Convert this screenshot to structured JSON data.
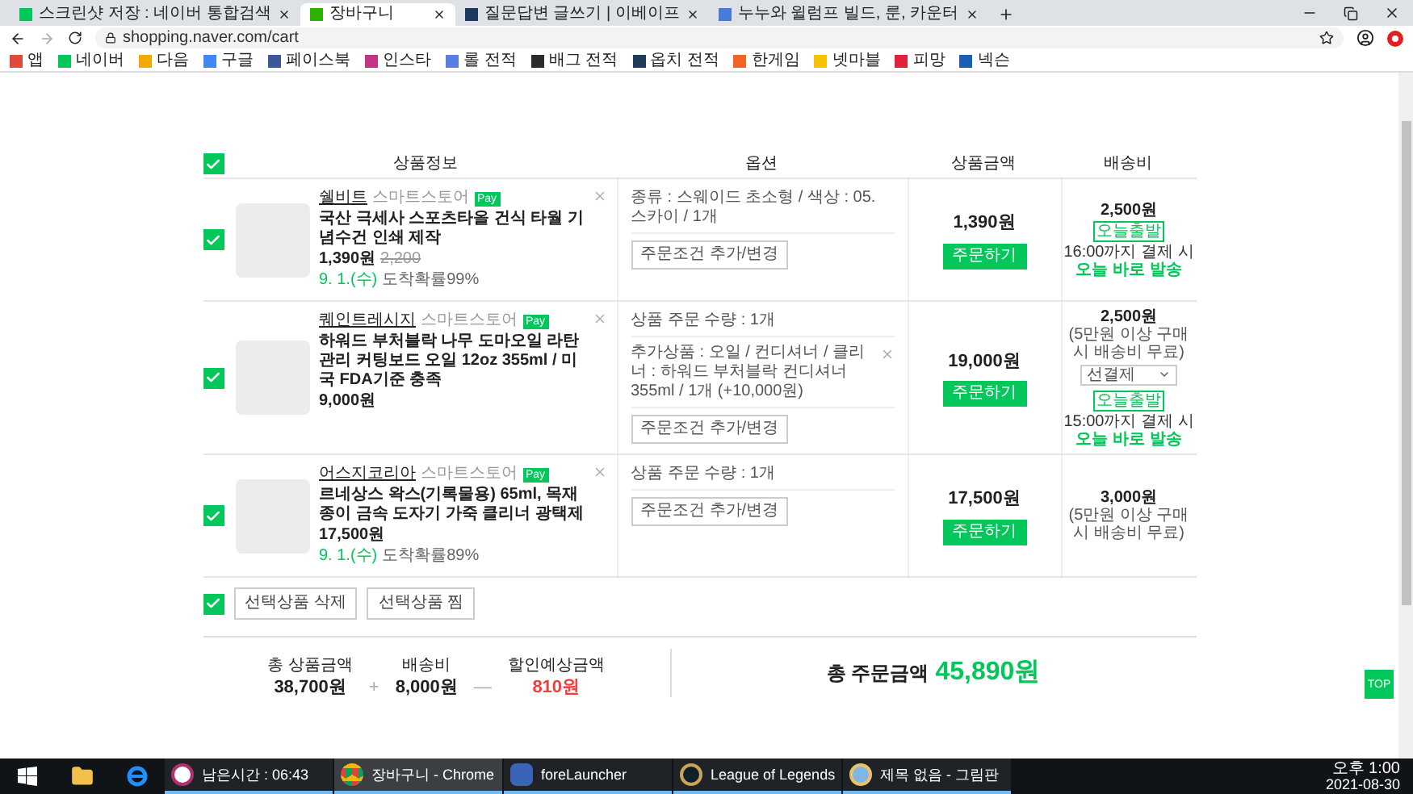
{
  "browser": {
    "tabs": [
      {
        "title": "스크린샷 저장 : 네이버 통합검색",
        "selected": false,
        "color": "#03c75a"
      },
      {
        "title": "장바구니",
        "selected": true,
        "color": "#2db400"
      },
      {
        "title": "질문답변 글쓰기 | 이베이프",
        "selected": false,
        "color": "#1e3a5f"
      },
      {
        "title": "누누와 윌럼프 빌드, 룬, 카운터",
        "selected": false,
        "color": "#4a7bd8"
      }
    ],
    "url": "shopping.naver.com/cart",
    "bookmarks": [
      {
        "label": "앱",
        "color": "#e04a3a"
      },
      {
        "label": "네이버",
        "color": "#03c75a"
      },
      {
        "label": "다음",
        "color": "#f2a900"
      },
      {
        "label": "구글",
        "color": "#4285f4"
      },
      {
        "label": "페이스북",
        "color": "#3b5998"
      },
      {
        "label": "인스타",
        "color": "#c13584"
      },
      {
        "label": "롤 전적",
        "color": "#5b7fde"
      },
      {
        "label": "배그 전적",
        "color": "#2b2b2b"
      },
      {
        "label": "옵치 전적",
        "color": "#1f3b5a"
      },
      {
        "label": "한게임",
        "color": "#f26522"
      },
      {
        "label": "넷마블",
        "color": "#f5c400"
      },
      {
        "label": "피망",
        "color": "#e0223a"
      },
      {
        "label": "넥슨",
        "color": "#1a5fb4"
      }
    ]
  },
  "cart": {
    "select_all": {
      "checked": true
    },
    "columns": [
      "상품정보",
      "옵션",
      "상품금액",
      "배송비"
    ],
    "items": [
      {
        "checked": true,
        "seller": "쉘비트",
        "store": "스마트스토어",
        "pay": "Pay",
        "name": "국산 극세사 스포츠타올 건식 타월 기념수건 인쇄 제작",
        "price": "1,390원",
        "original_price": "2,200",
        "arrival": "9. 1.(수)",
        "arrival_note": "도착확률99%",
        "options": [
          {
            "text": "종류 : 스웨이드 초소형 / 색상 : 05. 스카이 / 1개",
            "removable": false
          }
        ],
        "option_button": "주문조건 추가/변경",
        "amount": "1,390원",
        "order_button": "주문하기",
        "shipping": {
          "fee": "2,500원",
          "badge": "오늘출발",
          "deadline": "16:00까지 결제 시",
          "dispatch": "오늘 바로 발송"
        }
      },
      {
        "checked": true,
        "seller": "퀘인트레시지",
        "store": "스마트스토어",
        "pay": "Pay",
        "name": "하워드 부처블락 나무 도마오일 라탄 관리 커팅보드 오일 12oz 355ml / 미국 FDA기준 충족",
        "price": "9,000원",
        "options": [
          {
            "text": "상품 주문 수량 : 1개",
            "removable": false
          },
          {
            "text": "추가상품 : 오일 / 컨디셔너 / 클리너 : 하워드 부처블락 컨디셔너 355ml / 1개 (+10,000원)",
            "removable": true
          }
        ],
        "option_button": "주문조건 추가/변경",
        "amount": "19,000원",
        "order_button": "주문하기",
        "shipping": {
          "fee": "2,500원",
          "note": "(5만원 이상 구매 시 배송비 무료)",
          "payment_select": "선결제",
          "badge": "오늘출발",
          "deadline": "15:00까지 결제 시",
          "dispatch": "오늘 바로 발송"
        }
      },
      {
        "checked": true,
        "seller": "어스지코리아",
        "store": "스마트스토어",
        "pay": "Pay",
        "name": "르네상스 왁스(기록물용) 65ml, 목재 종이 금속 도자기 가죽 클리너 광택제",
        "price": "17,500원",
        "arrival": "9. 1.(수)",
        "arrival_note": "도착확률89%",
        "options": [
          {
            "text": "상품 주문 수량 : 1개",
            "removable": false
          }
        ],
        "option_button": "주문조건 추가/변경",
        "amount": "17,500원",
        "order_button": "주문하기",
        "shipping": {
          "fee": "3,000원",
          "note": "(5만원 이상 구매 시 배송비 무료)"
        }
      }
    ],
    "bottom_checkbox": {
      "checked": true
    },
    "actions": [
      "선택상품 삭제",
      "선택상품 찜"
    ],
    "totals": {
      "products_label": "총 상품금액",
      "products": "38,700원",
      "plus": "+",
      "shipping_label": "배송비",
      "shipping": "8,000원",
      "minus": "—",
      "discount_label": "할인예상금액",
      "discount": "810원",
      "order_label": "총 주문금액",
      "order": "45,890원"
    },
    "top_button": "TOP"
  },
  "taskbar": {
    "apps": [
      {
        "kind": "timer",
        "label": "남은시간 : 06:43",
        "selected": false
      },
      {
        "kind": "chrome",
        "label": "장바구니 - Chrome",
        "selected": true
      },
      {
        "kind": "launcher",
        "label": "foreLauncher",
        "selected": false
      },
      {
        "kind": "game",
        "label": "League of Legends",
        "selected": false
      },
      {
        "kind": "paint",
        "label": "제목 없음 - 그림판",
        "selected": false
      }
    ],
    "time": "오후 1:00",
    "date": "2021-08-30"
  }
}
